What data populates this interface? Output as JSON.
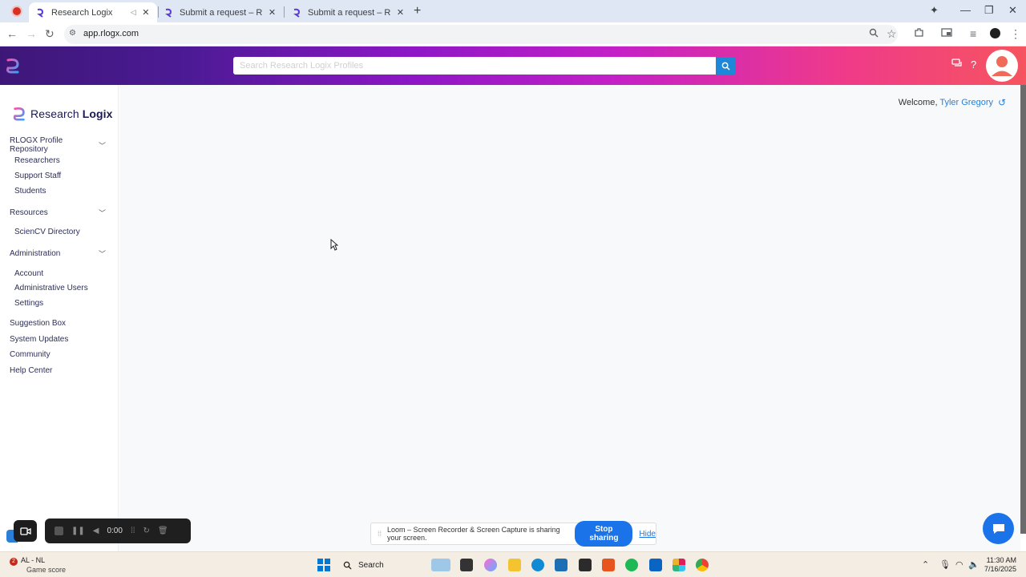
{
  "browser": {
    "tabs": [
      {
        "title": "Research Logix",
        "active": true
      },
      {
        "title": "Submit a request – Research Lo",
        "active": false
      },
      {
        "title": "Submit a request – Research Lo",
        "active": false
      }
    ],
    "url": "app.rlogx.com"
  },
  "header": {
    "search_placeholder": "Search Research Logix Profiles"
  },
  "sidebar": {
    "brand_part1": "Research",
    "brand_part2": "Logix",
    "sections": [
      {
        "label": "RLOGX Profile Repository",
        "items": [
          "Researchers",
          "Support Staff",
          "Students"
        ]
      },
      {
        "label": "Resources",
        "items": [
          "ScienCV Directory"
        ]
      },
      {
        "label": "Administration",
        "items": [
          "Account",
          "Administrative Users",
          "Settings"
        ]
      }
    ],
    "top_items": [
      "Suggestion Box",
      "System Updates",
      "Community",
      "Help Center"
    ]
  },
  "main": {
    "welcome_prefix": "Welcome,",
    "user_name": "Tyler Gregory"
  },
  "loom": {
    "timer": "0:00",
    "share_message": "Loom – Screen Recorder & Screen Capture is sharing your screen.",
    "stop_label": "Stop sharing",
    "hide_label": "Hide"
  },
  "taskbar": {
    "notif_count": "2",
    "weather_title": "AL - NL",
    "weather_sub": "Game score",
    "search_label": "Search",
    "time": "11:30 AM",
    "date": "7/16/2025"
  },
  "colors": {
    "header_gradient_start": "#3d1778",
    "header_gradient_end": "#f6545f",
    "accent_blue": "#1a73e8",
    "link_blue": "#2b7fd6"
  }
}
